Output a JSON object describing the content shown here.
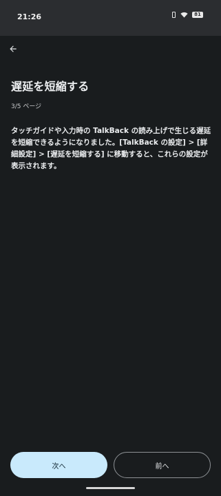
{
  "status_bar": {
    "time": "21:26",
    "battery": "81",
    "icons": [
      "vibrate-icon",
      "wifi-icon",
      "battery-icon"
    ]
  },
  "app_bar": {
    "back_icon": "arrow-back-icon"
  },
  "content": {
    "title": "遅延を短縮する",
    "page_indicator": "3/5 ページ",
    "body": "タッチガイドや入力時の TalkBack の読み上げで生じる遅延を短縮できるようになりました。[TalkBack の設定] > [詳細設定] > [遅延を短縮する] に移動すると、これらの設定が表示されます。"
  },
  "buttons": {
    "next_label": "次へ",
    "prev_label": "前へ"
  },
  "colors": {
    "background": "#191c1e",
    "status_bar": "#2b2d30",
    "primary_button": "#c9eafc",
    "outline": "#8e9296"
  }
}
